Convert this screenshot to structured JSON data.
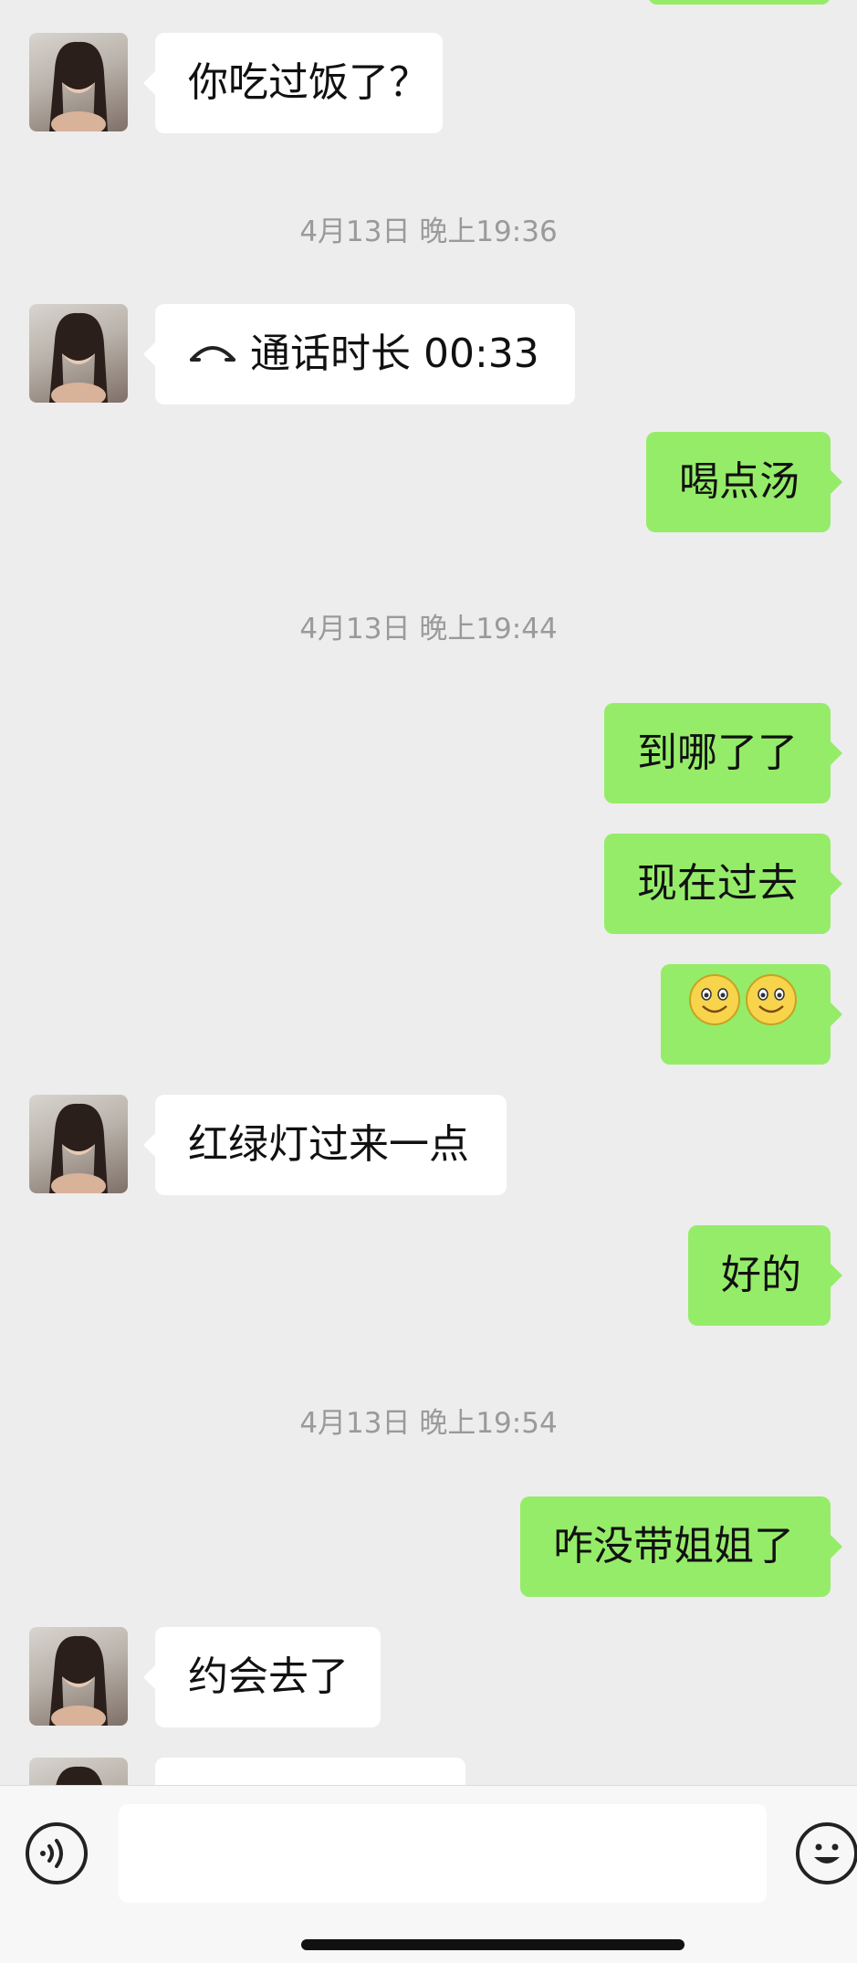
{
  "messages": [
    {
      "type": "in",
      "text": "你吃过饭了？"
    },
    {
      "type": "time",
      "text": "4月13日 晚上19:36"
    },
    {
      "type": "in",
      "call": true,
      "text": "通话时长 00:33"
    },
    {
      "type": "out",
      "text": "喝点汤"
    },
    {
      "type": "time",
      "text": "4月13日 晚上19:44"
    },
    {
      "type": "out",
      "text": "到哪了了"
    },
    {
      "type": "out",
      "text": "现在过去"
    },
    {
      "type": "out",
      "emoji": "smile-emoji",
      "emoji_count": 2
    },
    {
      "type": "in",
      "text": "红绿灯过来一点"
    },
    {
      "type": "out",
      "text": "好的"
    },
    {
      "type": "time",
      "text": "4月13日 晚上19:54"
    },
    {
      "type": "out",
      "text": "咋没带姐姐了"
    },
    {
      "type": "in",
      "text": "约会去了"
    }
  ],
  "input_bar": {
    "placeholder": "",
    "icons": [
      "voice-icon",
      "emoji-icon"
    ]
  },
  "colors": {
    "background": "#ededed",
    "bubble_in": "#ffffff",
    "bubble_out": "#95ec69",
    "timestamp": "#9a9a9a"
  }
}
